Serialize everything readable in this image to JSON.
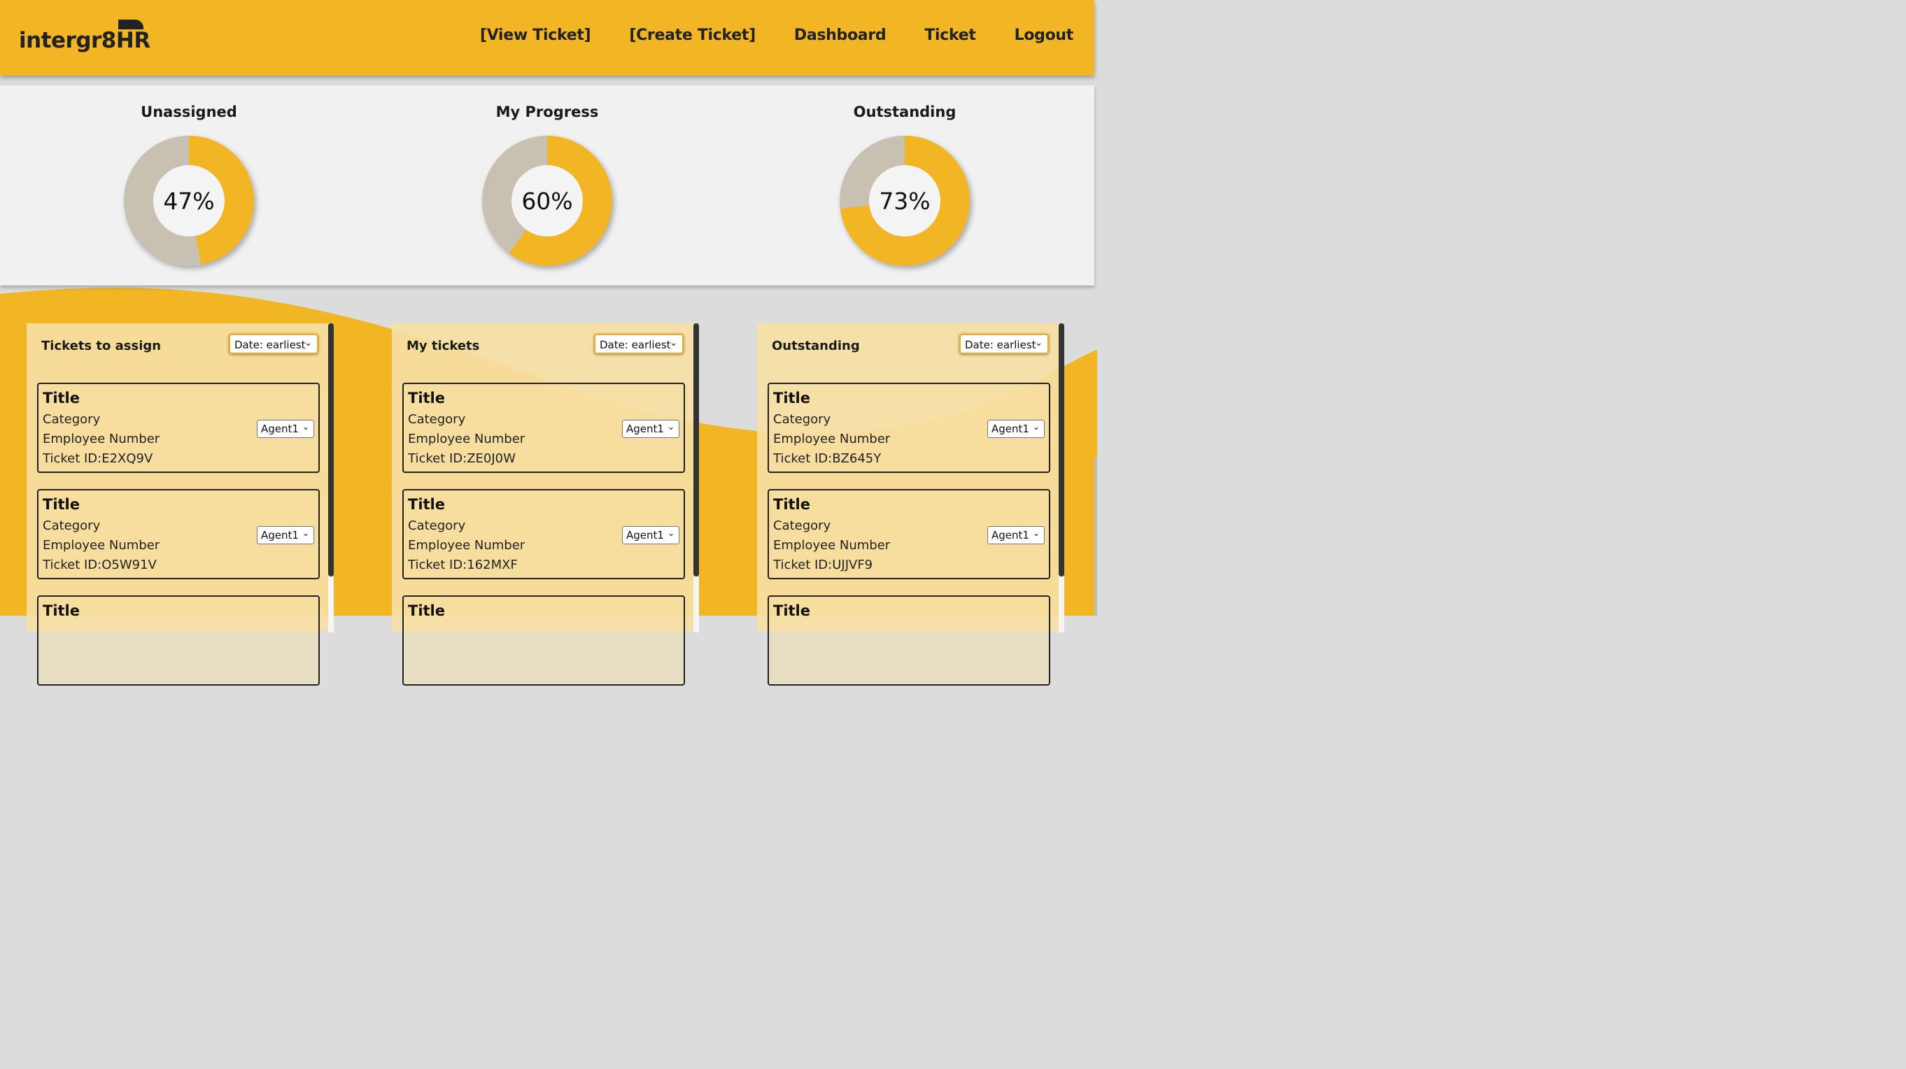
{
  "header": {
    "logo": "intergr8HR",
    "nav": [
      "[View Ticket]",
      "[Create Ticket]",
      "Dashboard",
      "Ticket",
      "Logout"
    ]
  },
  "stats": [
    {
      "title": "Unassigned",
      "percent_label": "47%",
      "value": 47
    },
    {
      "title": "My Progress",
      "percent_label": "60%",
      "value": 60
    },
    {
      "title": "Outstanding",
      "percent_label": "73%",
      "value": 73
    }
  ],
  "colors": {
    "accent": "#f2b523",
    "remaining": "#c8c0b0"
  },
  "columns": [
    {
      "heading": "Tickets to assign",
      "sort": "Date: earliest",
      "cards": [
        {
          "title": "Title",
          "category": "Category",
          "employee": "Employee Number",
          "ticket_id": "Ticket ID:E2XQ9V",
          "agent": "Agent1"
        },
        {
          "title": "Title",
          "category": "Category",
          "employee": "Employee Number",
          "ticket_id": "Ticket ID:O5W91V",
          "agent": "Agent1"
        },
        {
          "title": "Title"
        }
      ]
    },
    {
      "heading": "My tickets",
      "sort": "Date: earliest",
      "cards": [
        {
          "title": "Title",
          "category": "Category",
          "employee": "Employee Number",
          "ticket_id": "Ticket ID:ZE0J0W",
          "agent": "Agent1"
        },
        {
          "title": "Title",
          "category": "Category",
          "employee": "Employee Number",
          "ticket_id": "Ticket ID:162MXF",
          "agent": "Agent1"
        },
        {
          "title": "Title"
        }
      ]
    },
    {
      "heading": "Outstanding",
      "sort": "Date: earliest",
      "cards": [
        {
          "title": "Title",
          "category": "Category",
          "employee": "Employee Number",
          "ticket_id": "Ticket ID:BZ645Y",
          "agent": "Agent1"
        },
        {
          "title": "Title",
          "category": "Category",
          "employee": "Employee Number",
          "ticket_id": "Ticket ID:UJJVF9",
          "agent": "Agent1"
        },
        {
          "title": "Title"
        }
      ]
    }
  ]
}
